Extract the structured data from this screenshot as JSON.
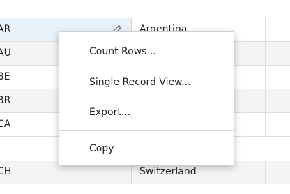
{
  "grid": {
    "rows": [
      {
        "code": "AR",
        "name": "Argentina",
        "selected": true
      },
      {
        "code": "AU",
        "name": ""
      },
      {
        "code": "BE",
        "name": ""
      },
      {
        "code": "BR",
        "name": ""
      },
      {
        "code": "CA",
        "name": ""
      },
      {
        "code": "CH",
        "name": "Switzerland"
      }
    ]
  },
  "context_menu": {
    "items": [
      {
        "label": "Count Rows..."
      },
      {
        "label": "Single Record View..."
      },
      {
        "label": "Export..."
      },
      {
        "label": "Copy"
      }
    ]
  },
  "icons": {
    "edit": "pencil-icon"
  },
  "colors": {
    "selected_cell": "#e7f2fb",
    "alt_row": "#f4f4f4"
  }
}
